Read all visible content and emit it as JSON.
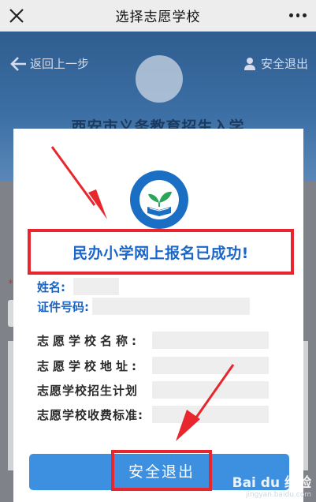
{
  "nav": {
    "title": "选择志愿学校",
    "close_icon": "close-icon",
    "more_icon": "more-icon"
  },
  "background": {
    "back_label": "返回上一步",
    "exit_label": "安全退出",
    "caption": "西安市义务教育招生入学",
    "required_mark": "*"
  },
  "modal": {
    "logo": {
      "ring_text": "COMPULSORY EDUCATION",
      "inner_text": "西安市义务教育招生入学报名平台"
    },
    "success_message": "民办小学网上报名已成功!",
    "fields": [
      {
        "label": "姓名:",
        "value": ""
      },
      {
        "label": "证件号码:",
        "value": ""
      }
    ],
    "school_fields": [
      {
        "label": "志愿学校名称:",
        "value": ""
      },
      {
        "label": "志愿学校地址:",
        "value": ""
      },
      {
        "label": "志愿学校招生计划",
        "value": ""
      },
      {
        "label": "志愿学校收费标准:",
        "value": ""
      }
    ],
    "exit_button": "安全退出"
  },
  "watermark": {
    "main": "Bai du 经验",
    "sub": "jingyan.baidu.com"
  },
  "colors": {
    "accent_blue": "#1a67c9",
    "button_blue": "#3d8fe0",
    "highlight_red": "#e8262d"
  }
}
